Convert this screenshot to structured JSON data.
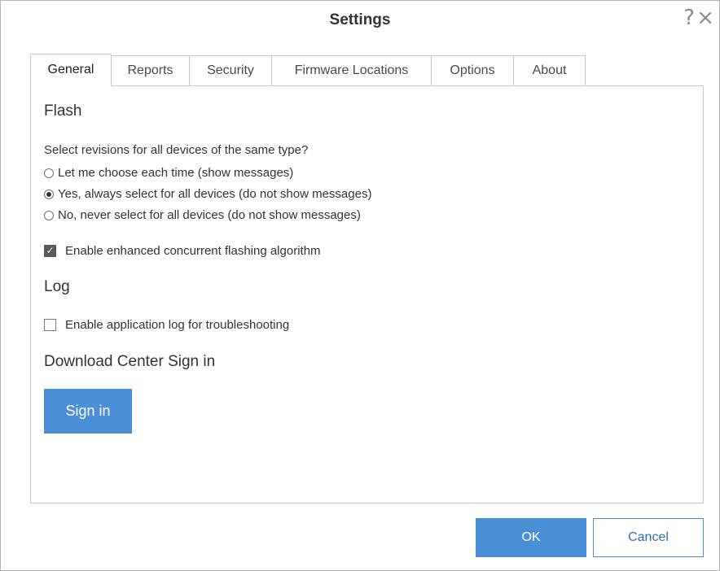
{
  "window": {
    "title": "Settings",
    "help_glyph": "?",
    "close_glyph": "×"
  },
  "tabs": [
    {
      "label": "General",
      "active": true
    },
    {
      "label": "Reports",
      "active": false
    },
    {
      "label": "Security",
      "active": false
    },
    {
      "label": "Firmware Locations",
      "active": false
    },
    {
      "label": "Options",
      "active": false
    },
    {
      "label": "About",
      "active": false
    }
  ],
  "flash": {
    "heading": "Flash",
    "question": "Select revisions for all devices of the same type?",
    "options": [
      {
        "label": "Let me choose each time (show messages)",
        "selected": false
      },
      {
        "label": "Yes, always select for all devices (do not show messages)",
        "selected": true
      },
      {
        "label": "No, never select for all devices (do not show messages)",
        "selected": false
      }
    ],
    "enhanced_label": "Enable enhanced concurrent flashing algorithm",
    "enhanced_checked": true
  },
  "log": {
    "heading": "Log",
    "app_log_label": "Enable application log for troubleshooting",
    "app_log_checked": false
  },
  "download_center": {
    "heading": "Download Center Sign in",
    "signin_label": "Sign in"
  },
  "footer": {
    "ok_label": "OK",
    "cancel_label": "Cancel"
  },
  "colors": {
    "accent": "#4a8fd5",
    "border": "#c8c8c8"
  }
}
